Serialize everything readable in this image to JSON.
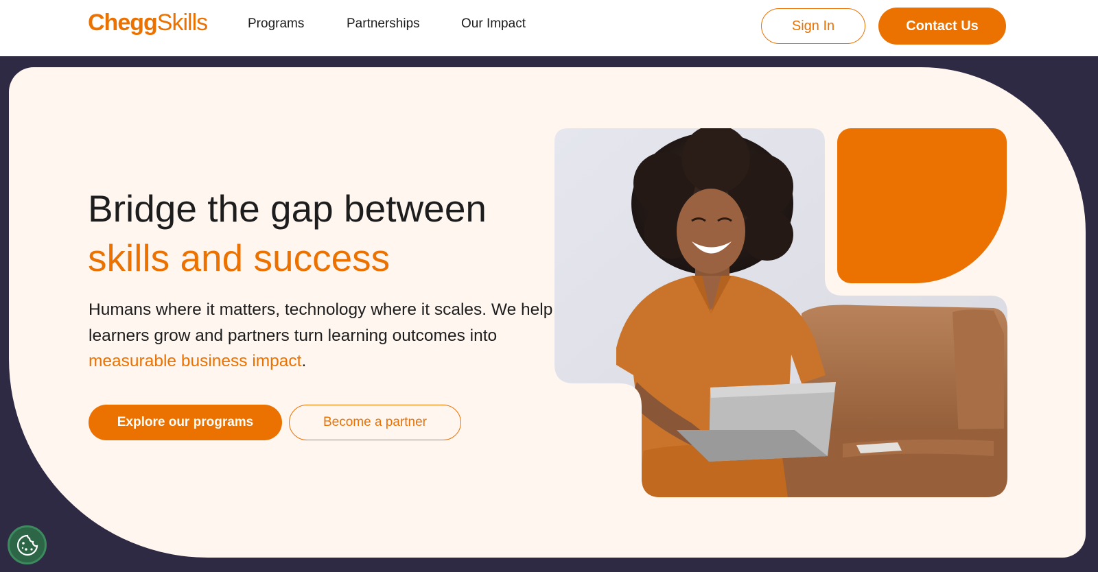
{
  "header": {
    "logo": {
      "part1": "Chegg",
      "part2": "Skills"
    },
    "nav": [
      {
        "label": "Programs"
      },
      {
        "label": "Partnerships"
      },
      {
        "label": "Our Impact"
      }
    ],
    "signin_label": "Sign In",
    "contact_label": "Contact Us"
  },
  "hero": {
    "headline_line1": "Bridge the gap between",
    "headline_line2": "skills and success",
    "body_part1": "Humans where it matters, technology where it scales. We help learners grow and partners turn learning outcomes into ",
    "body_link": "measurable business impact",
    "body_end": ".",
    "primary_cta": "Explore our programs",
    "secondary_cta": "Become a partner",
    "photo_alt": "Smiling woman with curly hair in an orange jumpsuit sitting on a brown leather sofa with a laptop"
  },
  "cookie": {
    "icon": "cookie-icon",
    "aria_label": "Cookie settings"
  },
  "colors": {
    "accent": "#eb7100",
    "hero_bg": "#fff6f0",
    "page_bg": "#2e2a43",
    "text": "#1d1d1d",
    "cookie_bg": "#2c6647"
  }
}
